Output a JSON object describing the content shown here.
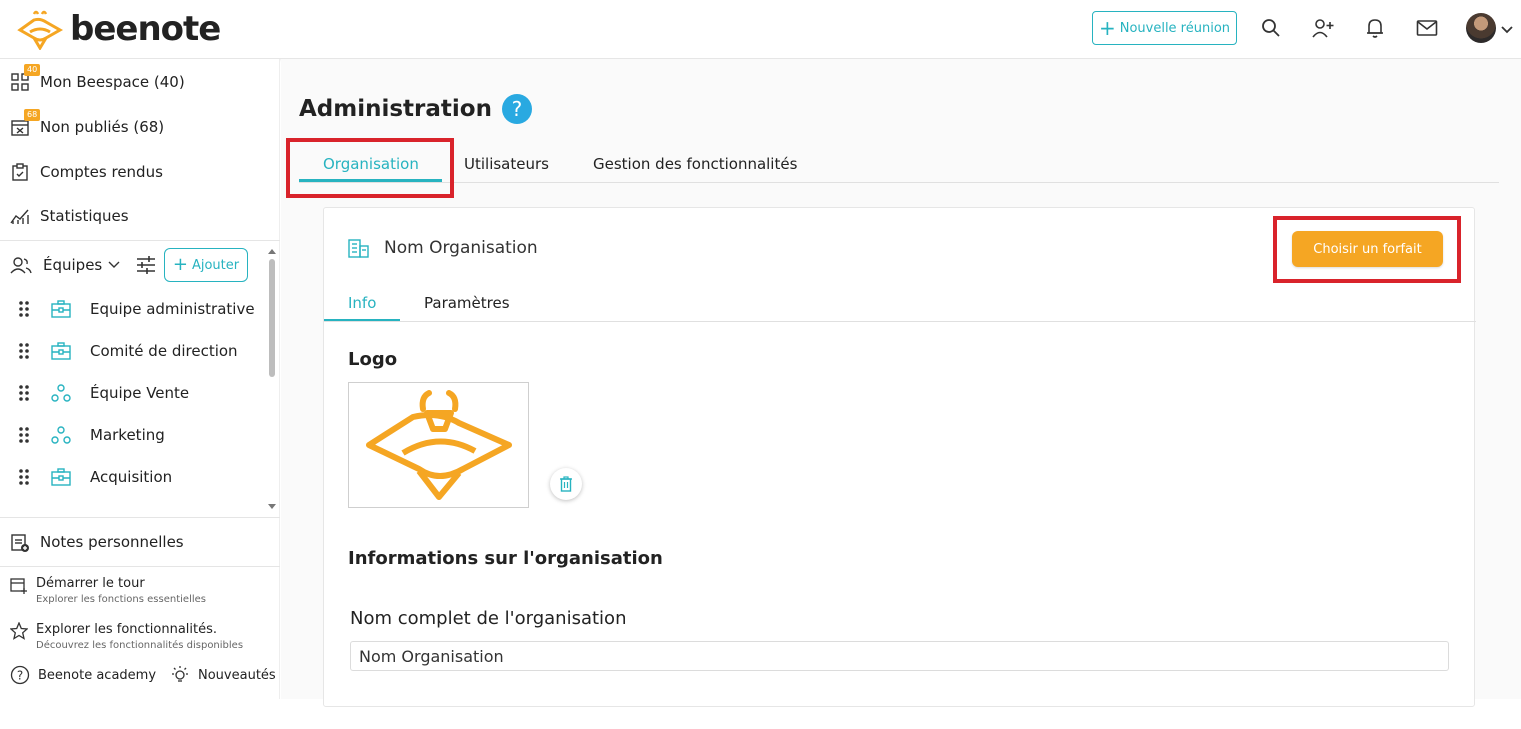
{
  "brand": {
    "name": "beenote"
  },
  "header": {
    "new_meeting_label": "Nouvelle réunion"
  },
  "sidebar": {
    "nav": [
      {
        "label": "Mon Beespace (40)",
        "badge": "40"
      },
      {
        "label": "Non publiés (68)",
        "badge": "68"
      },
      {
        "label": "Comptes rendus"
      },
      {
        "label": "Statistiques"
      }
    ],
    "teams_label": "Équipes",
    "add_label": "Ajouter",
    "teams": [
      {
        "name": "Equipe administrative",
        "icon": "briefcase-icon"
      },
      {
        "name": "Comité de direction",
        "icon": "briefcase-icon"
      },
      {
        "name": "Équipe Vente",
        "icon": "group-icon"
      },
      {
        "name": "Marketing",
        "icon": "group-icon"
      },
      {
        "name": "Acquisition",
        "icon": "briefcase-icon"
      }
    ],
    "personal_notes": "Notes personnelles",
    "tour": {
      "title": "Démarrer le tour",
      "subtitle": "Explorer les fonctions essentielles"
    },
    "explore": {
      "title": "Explorer les fonctionnalités.",
      "subtitle": "Découvrez les fonctionnalités disponibles"
    },
    "academy": "Beenote academy",
    "news": "Nouveautés"
  },
  "main": {
    "title": "Administration",
    "help": "?",
    "tabs": [
      "Organisation",
      "Utilisateurs",
      "Gestion des fonctionnalités"
    ],
    "org_name": "Nom Organisation",
    "choose_plan": "Choisir un forfait",
    "subtabs": [
      "Info",
      "Paramètres"
    ],
    "logo_label": "Logo",
    "info_heading": "Informations sur l'organisation",
    "full_name_label": "Nom complet de l'organisation",
    "full_name_value": "Nom Organisation"
  },
  "colors": {
    "accent": "#27b3c0",
    "orange": "#f5a623",
    "highlight": "#d9232b"
  }
}
